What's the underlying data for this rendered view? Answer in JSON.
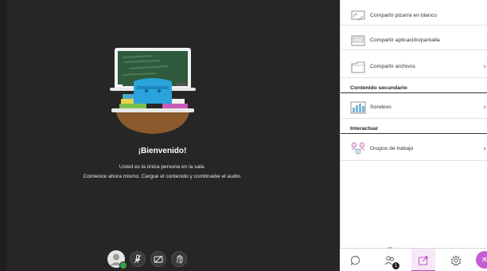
{
  "welcome": {
    "title": "¡Bienvenido!",
    "line1": "Usted es la única persona en la sala.",
    "line2": "Comience ahora mismo. Cargue el contenido y combruebe el audio."
  },
  "controls": [
    {
      "icon": "avatar-icon"
    },
    {
      "icon": "microphone-muted-icon"
    },
    {
      "icon": "camera-off-icon"
    },
    {
      "icon": "raise-hand-icon"
    }
  ],
  "panel": {
    "share_items": [
      {
        "label": "Compartir pizarra en blanco",
        "icon": "whiteboard-icon",
        "chevron": ""
      },
      {
        "label": "Compartir aplicación/pantalla",
        "icon": "screen-share-icon",
        "chevron": ""
      },
      {
        "label": "Compartir archivos",
        "icon": "folder-icon",
        "chevron": "›"
      }
    ],
    "secondary_heading": "Contenido secundario",
    "secondary_items": [
      {
        "label": "Sondeos",
        "icon": "poll-icon",
        "chevron": "›"
      }
    ],
    "interact_heading": "Interactuar",
    "interact_items": [
      {
        "label": "Grupos de trabajo",
        "icon": "breakout-groups-icon",
        "chevron": "›"
      }
    ]
  },
  "tabbar": {
    "attendees_badge": "1",
    "accent_color": "#b54cc1"
  }
}
